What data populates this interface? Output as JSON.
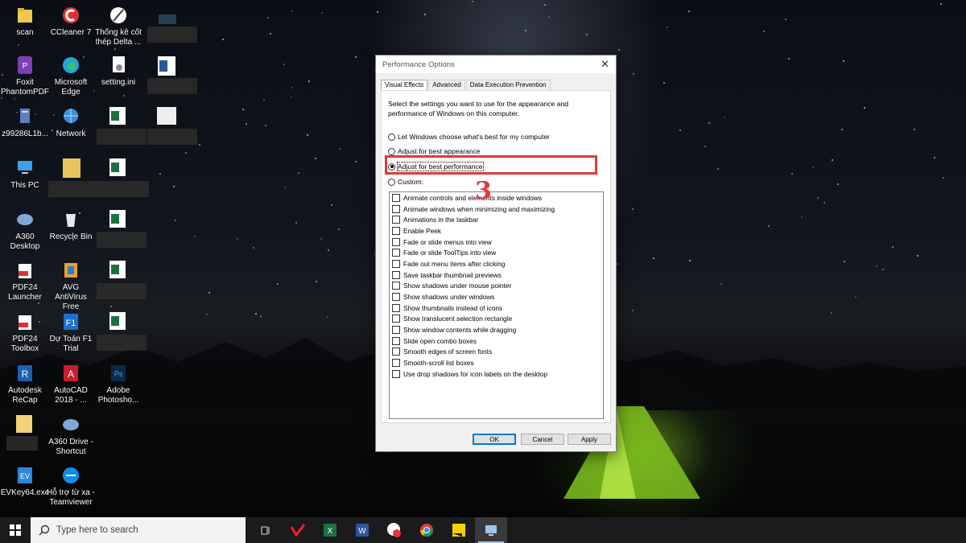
{
  "desktop_icons": [
    {
      "label": "scan",
      "icon": "folder-icon"
    },
    {
      "label": "CCleaner 7",
      "icon": "ccleaner-icon"
    },
    {
      "label": "Thống kê cốt thép Delta ...",
      "icon": "pen-tool-icon"
    },
    {
      "label": "Foxit PhantomPDF",
      "icon": "foxit-icon"
    },
    {
      "label": "Microsoft Edge",
      "icon": "edge-icon"
    },
    {
      "label": "setting.ini",
      "icon": "settings-file-icon"
    },
    {
      "label": "z99286L1b...",
      "icon": "server-icon"
    },
    {
      "label": "Network",
      "icon": "network-icon"
    },
    {
      "label": "This PC",
      "icon": "computer-icon"
    },
    {
      "label": "A360 Desktop",
      "icon": "a360-icon"
    },
    {
      "label": "Recycle Bin",
      "icon": "recycle-bin-icon"
    },
    {
      "label": "PDF24 Launcher",
      "icon": "pdf24-icon"
    },
    {
      "label": "AVG AntiVirus Free",
      "icon": "avg-icon"
    },
    {
      "label": "PDF24 Toolbox",
      "icon": "pdf24-toolbox-icon"
    },
    {
      "label": "Dự Toán F1 Trial",
      "icon": "f1-icon"
    },
    {
      "label": "Autodesk ReCap",
      "icon": "recap-icon"
    },
    {
      "label": "AutoCAD 2018 - ...",
      "icon": "autocad-icon"
    },
    {
      "label": "Adobe Photosho...",
      "icon": "photoshop-icon"
    },
    {
      "label": "A360 Drive - Shortcut",
      "icon": "a360-drive-icon"
    },
    {
      "label": "EVKey64.exe",
      "icon": "evkey-icon"
    },
    {
      "label": "Hỗ trợ từ xa - Teamviewer",
      "icon": "teamviewer-icon"
    }
  ],
  "dialog": {
    "title": "Performance Options",
    "tabs": [
      "Visual Effects",
      "Advanced",
      "Data Execution Prevention"
    ],
    "description": "Select the settings you want to use for the appearance and performance of Windows on this computer.",
    "radios": [
      {
        "label": "Let Windows choose what's best for my computer",
        "selected": false
      },
      {
        "label": "Adjust for best appearance",
        "selected": false
      },
      {
        "label": "Adjust for best performance",
        "selected": true
      },
      {
        "label": "Custom:",
        "selected": false
      }
    ],
    "annotation_number": "3",
    "annotation_color": "#e03a3a",
    "effects": [
      "Animate controls and elements inside windows",
      "Animate windows when minimizing and maximizing",
      "Animations in the taskbar",
      "Enable Peek",
      "Fade or slide menus into view",
      "Fade or slide ToolTips into view",
      "Fade out menu items after clicking",
      "Save taskbar thumbnail previews",
      "Show shadows under mouse pointer",
      "Show shadows under windows",
      "Show thumbnails instead of icons",
      "Show translucent selection rectangle",
      "Show window contents while dragging",
      "Slide open combo boxes",
      "Smooth edges of screen fonts",
      "Smooth-scroll list boxes",
      "Use drop shadows for icon labels on the desktop"
    ],
    "buttons": {
      "ok": "OK",
      "cancel": "Cancel",
      "apply": "Apply"
    }
  },
  "taskbar": {
    "search_placeholder": "Type here to search",
    "apps": [
      "task-view-icon",
      "vietnamese-app-icon",
      "excel-icon",
      "word-icon",
      "app-badge-icon",
      "chrome-icon",
      "sticky-notes-icon",
      "system-properties-icon"
    ]
  }
}
